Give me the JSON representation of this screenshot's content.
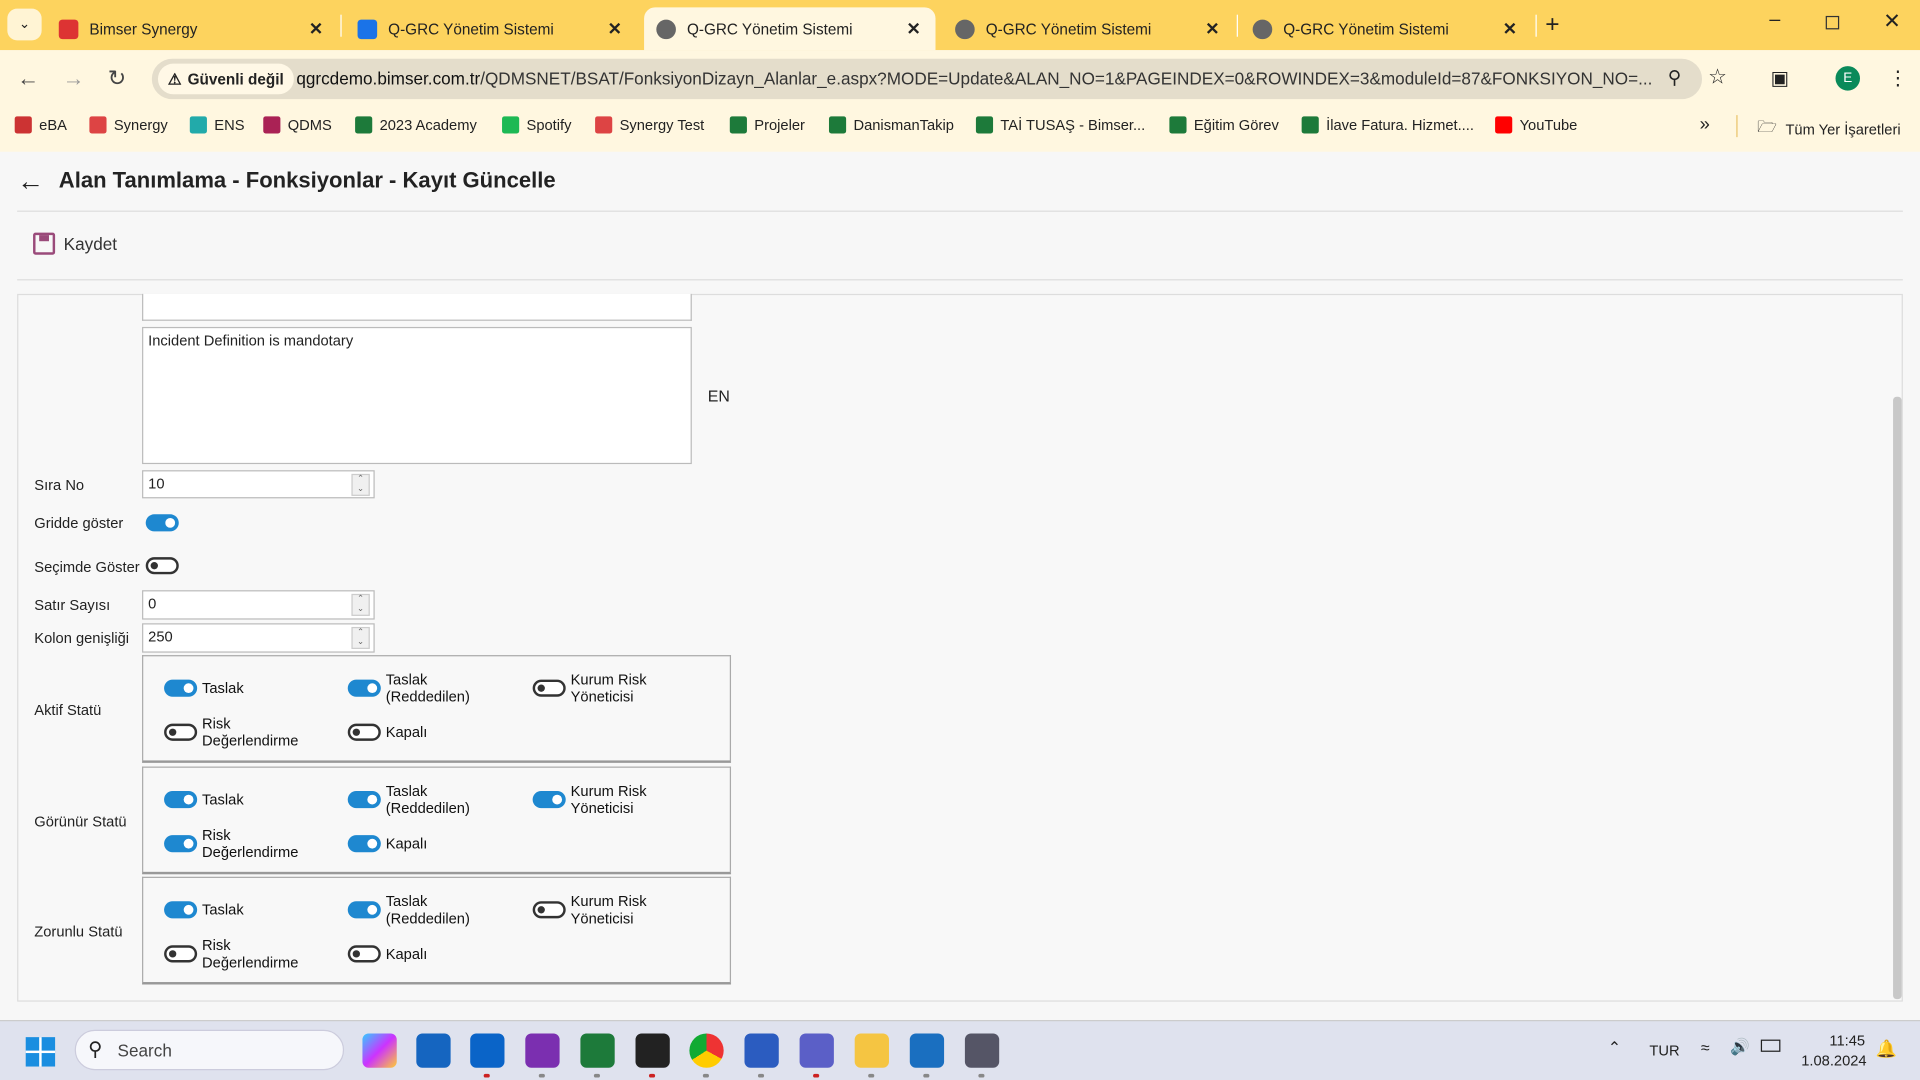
{
  "browser": {
    "tabs": [
      {
        "label": "Bimser Synergy",
        "active": false
      },
      {
        "label": "Q-GRC Yönetim Sistemi",
        "active": false
      },
      {
        "label": "Q-GRC Yönetim Sistemi",
        "active": true
      },
      {
        "label": "Q-GRC Yönetim Sistemi",
        "active": false
      },
      {
        "label": "Q-GRC Yönetim Sistemi",
        "active": false
      }
    ],
    "security_label": "Güvenli değil",
    "url_host": "qgrcdemo.bimser.com.tr",
    "url_path": "/QDMSNET/BSAT/FonksiyonDizayn_Alanlar_e.aspx?MODE=Update&ALAN_NO=1&PAGEINDEX=0&ROWINDEX=3&moduleId=87&FONKSIYON_NO=...",
    "profile_initial": "E",
    "bookmarks": [
      "eBA",
      "Synergy",
      "ENS",
      "QDMS",
      "2023 Academy",
      "Spotify",
      "Synergy Test",
      "Projeler",
      "DanismanTakip",
      "TAİ TUSAŞ - Bimser...",
      "Eğitim Görev",
      "İlave Fatura. Hizmet....",
      "YouTube"
    ],
    "more_bookmarks": "»",
    "all_bookmarks": "Tüm Yer İşaretleri"
  },
  "page": {
    "title": "Alan Tanımlama - Fonksiyonlar - Kayıt Güncelle",
    "save_label": "Kaydet",
    "textarea_value": "Incident Definition is mandotary",
    "lang_label": "EN",
    "fields": {
      "sira_no": {
        "label": "Sıra No",
        "value": "10"
      },
      "gridde": {
        "label": "Gridde göster",
        "on": true
      },
      "secimde": {
        "label": "Seçimde Göster",
        "on": false
      },
      "satir": {
        "label": "Satır Sayısı",
        "value": "0"
      },
      "kolon": {
        "label": "Kolon genişliği",
        "value": "250"
      }
    },
    "status_groups": [
      {
        "label": "Aktif Statü",
        "items": [
          {
            "label": "Taslak",
            "on": true
          },
          {
            "label": "Taslak (Reddedilen)",
            "on": true
          },
          {
            "label": "Kurum Risk Yöneticisi",
            "on": false
          },
          {
            "label": "Risk Değerlendirme",
            "on": false
          },
          {
            "label": "Kapalı",
            "on": false
          }
        ]
      },
      {
        "label": "Görünür Statü",
        "items": [
          {
            "label": "Taslak",
            "on": true
          },
          {
            "label": "Taslak (Reddedilen)",
            "on": true
          },
          {
            "label": "Kurum Risk Yöneticisi",
            "on": true
          },
          {
            "label": "Risk Değerlendirme",
            "on": true
          },
          {
            "label": "Kapalı",
            "on": true
          }
        ]
      },
      {
        "label": "Zorunlu Statü",
        "items": [
          {
            "label": "Taslak",
            "on": true
          },
          {
            "label": "Taslak (Reddedilen)",
            "on": true
          },
          {
            "label": "Kurum Risk Yöneticisi",
            "on": false
          },
          {
            "label": "Risk Değerlendirme",
            "on": false
          },
          {
            "label": "Kapalı",
            "on": false
          }
        ]
      }
    ]
  },
  "taskbar": {
    "search_placeholder": "Search",
    "lang": "TUR",
    "time": "11:45",
    "date": "1.08.2024"
  },
  "colors": {
    "accent": "#1e88d0",
    "tabbar": "#fdd35e"
  }
}
